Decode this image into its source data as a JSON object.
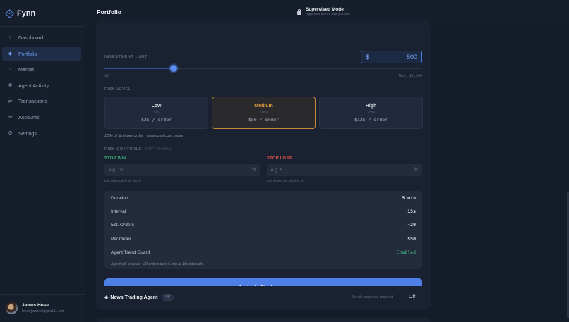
{
  "app": {
    "name": "Fynn"
  },
  "sidebar": {
    "items": [
      {
        "label": "Dashboard",
        "icon": "circle-icon",
        "glyph": "○",
        "active": false
      },
      {
        "label": "Portfolio",
        "icon": "diamond-icon",
        "glyph": "◆",
        "active": true
      },
      {
        "label": "Market",
        "icon": "arrow-up-icon",
        "glyph": "↑",
        "active": false
      },
      {
        "label": "Agent Activity",
        "icon": "sun-icon",
        "glyph": "✺",
        "active": false
      },
      {
        "label": "Transactions",
        "icon": "swap-icon",
        "glyph": "⇄",
        "active": false
      },
      {
        "label": "Accounts",
        "icon": "arrow-right-icon",
        "glyph": "➜",
        "active": false
      },
      {
        "label": "Settings",
        "icon": "gear-icon",
        "glyph": "⚙",
        "active": false
      }
    ],
    "user": {
      "name": "James Hose",
      "email": "hosejames6@gmail.com"
    }
  },
  "header": {
    "title": "Portfolio",
    "mode_title": "Supervised Mode",
    "mode_subtitle": "Approves before every action"
  },
  "strategy": {
    "investment_label": "INVESTMENT LIMIT",
    "currency": "$",
    "amount": "500",
    "slider_min": "$5",
    "slider_max": "Max: $2,346",
    "slider_fraction": 0.22,
    "risk_label": "RISK LEVEL",
    "risk_levels": [
      {
        "name": "Low",
        "pct": "5%",
        "order": "$25 / order",
        "selected": false
      },
      {
        "name": "Medium",
        "pct": "10%",
        "order": "$50 / order",
        "selected": true
      },
      {
        "name": "High",
        "pct": "25%",
        "order": "$125 / order",
        "selected": false
      }
    ],
    "risk_note": "10% of limit per order · balanced cost basis",
    "controls_label": "RISK CONTROLS",
    "controls_optional": "(OPTIONAL)",
    "stop_win": {
      "label": "STOP WIN",
      "placeholder": "e.g. 10",
      "suffix": "%",
      "hint": "Exit when gain hits this %",
      "color": "#3fb67a"
    },
    "stop_loss": {
      "label": "STOP LOSS",
      "placeholder": "e.g. 5",
      "suffix": "%",
      "hint": "Exit when loss hits this %",
      "color": "#e5534b"
    },
    "summary": [
      {
        "key": "Duration",
        "value": "5 min"
      },
      {
        "key": "Interval",
        "value": "15s"
      },
      {
        "key": "Est. Orders",
        "value": "~20"
      },
      {
        "key": "Per Order",
        "value": "$50"
      },
      {
        "key": "Agent Trend Guard",
        "value": "Enabled"
      }
    ],
    "summary_note": "Agent will execute ~20 orders over 5 min at 15s intervals.",
    "cta_label": "Activate Strategy →"
  },
  "news_agent": {
    "name": "News Trading Agent",
    "badge": "Off",
    "sends": "Sends approval request",
    "status": "Off"
  },
  "colors": {
    "accent": "#4d7fe6",
    "selected": "#e9a23d",
    "success": "#3fb67a",
    "danger": "#e5534b"
  }
}
